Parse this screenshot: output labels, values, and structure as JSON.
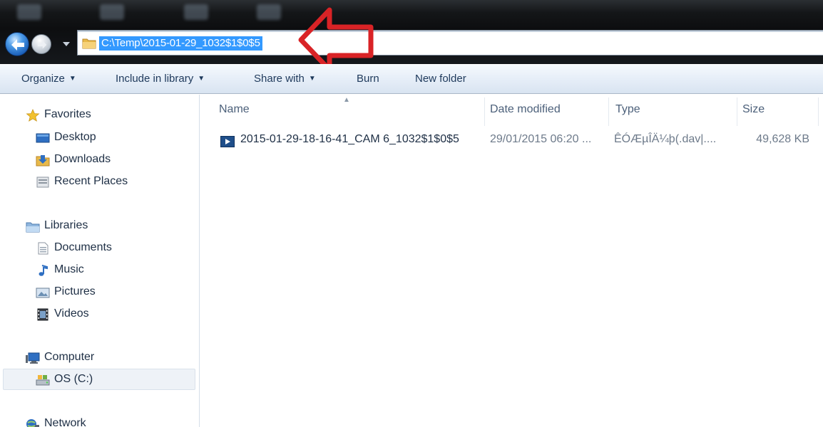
{
  "address": {
    "path": "C:\\Temp\\2015-01-29_1032$1$0$5"
  },
  "toolbar": {
    "organize": "Organize",
    "include_in_library": "Include in library",
    "share_with": "Share with",
    "burn": "Burn",
    "new_folder": "New folder"
  },
  "nav": {
    "favorites": "Favorites",
    "desktop": "Desktop",
    "downloads": "Downloads",
    "recent_places": "Recent Places",
    "libraries": "Libraries",
    "documents": "Documents",
    "music": "Music",
    "pictures": "Pictures",
    "videos": "Videos",
    "computer": "Computer",
    "os_c": "OS (C:)",
    "network": "Network"
  },
  "columns": {
    "name": "Name",
    "date_modified": "Date modified",
    "type": "Type",
    "size": "Size"
  },
  "files": [
    {
      "name": "2015-01-29-18-16-41_CAM 6_1032$1$0$5",
      "date_modified": "29/01/2015 06:20 ...",
      "type": "ÊÓÆµÎÄ¼þ(.dav|....",
      "size": "49,628 KB"
    }
  ],
  "colors": {
    "selection": "#3399ff",
    "arrow": "#d92326",
    "toolbar_text": "#1e395b"
  }
}
